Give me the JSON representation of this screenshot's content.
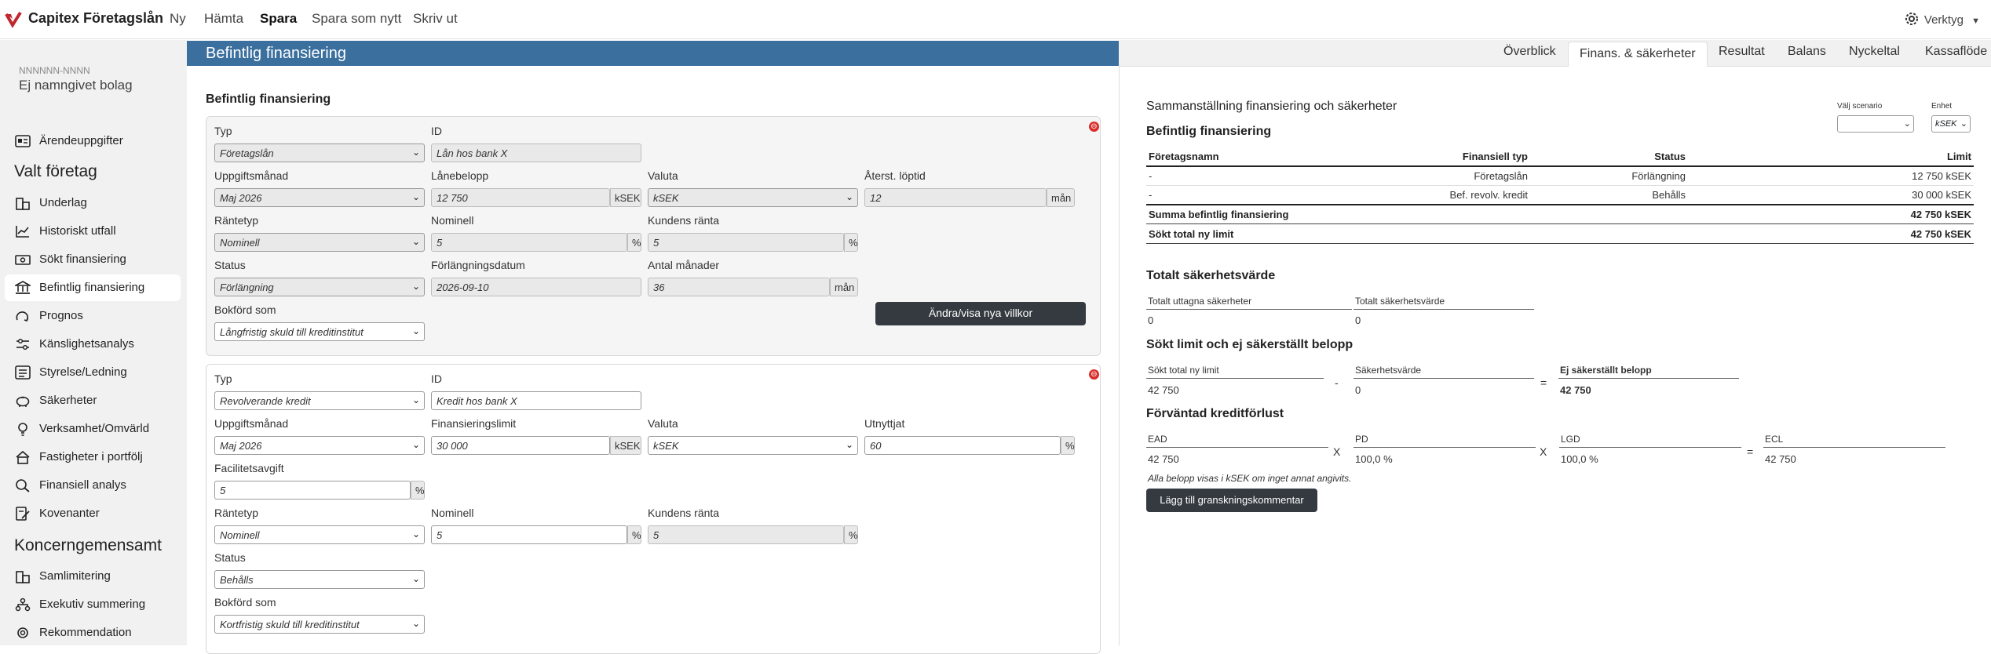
{
  "app": {
    "brand": "Capitex Företagslån"
  },
  "topnav": {
    "items": [
      "Ny",
      "Hämta",
      "Spara",
      "Spara som nytt",
      "Skriv ut"
    ],
    "tools_label": "Verktyg"
  },
  "sidebar": {
    "entity_id": "NNNNNN-NNNN",
    "entity_name": "Ej namngivet bolag",
    "top_item": "Ärendeuppgifter",
    "group1_title": "Valt företag",
    "group1_items": [
      "Underlag",
      "Historiskt utfall",
      "Sökt finansiering",
      "Befintlig finansiering",
      "Prognos",
      "Känslighetsanalys",
      "Styrelse/Ledning",
      "Säkerheter",
      "Verksamhet/Omvärld",
      "Fastigheter i portfölj",
      "Finansiell analys",
      "Kovenanter"
    ],
    "group2_title": "Koncerngemensamt",
    "group2_items": [
      "Samlimitering",
      "Exekutiv summering",
      "Rekommendation"
    ]
  },
  "mid": {
    "header": "Befintlig finansiering",
    "section_title": "Befintlig finansiering",
    "loan1": {
      "typ_label": "Typ",
      "typ": "Företagslån",
      "id_label": "ID",
      "id": "Lån hos bank X",
      "month_label": "Uppgiftsmånad",
      "month": "Maj 2026",
      "amount_label": "Lånebelopp",
      "amount": "12 750",
      "amount_unit": "kSEK",
      "currency_label": "Valuta",
      "currency": "kSEK",
      "remaining_label": "Återst. löptid",
      "remaining": "12",
      "remaining_unit": "mån",
      "rate_type_label": "Räntetyp",
      "rate_type": "Nominell",
      "nominal_label": "Nominell",
      "nominal": "5",
      "nominal_unit": "%",
      "customer_rate_label": "Kundens ränta",
      "customer_rate": "5",
      "customer_rate_unit": "%",
      "status_label": "Status",
      "status": "Förlängning",
      "ext_date_label": "Förlängningsdatum",
      "ext_date": "2026-09-10",
      "months_label": "Antal månader",
      "months": "36",
      "months_unit": "mån",
      "booked_label": "Bokförd som",
      "booked": "Långfristig skuld till kreditinstitut",
      "button": "Ändra/visa nya villkor"
    },
    "loan2": {
      "typ_label": "Typ",
      "typ": "Revolverande kredit",
      "id_label": "ID",
      "id": "Kredit hos bank X",
      "month_label": "Uppgiftsmånad",
      "month": "Maj 2026",
      "limit_label": "Finansieringslimit",
      "limit": "30 000",
      "limit_unit": "kSEK",
      "currency_label": "Valuta",
      "currency": "kSEK",
      "used_label": "Utnyttjat",
      "used": "60",
      "used_unit": "%",
      "fee_label": "Facilitetsavgift",
      "fee": "5",
      "fee_unit": "%",
      "rate_type_label": "Räntetyp",
      "rate_type": "Nominell",
      "nominal_label": "Nominell",
      "nominal": "5",
      "nominal_unit": "%",
      "customer_rate_label": "Kundens ränta",
      "customer_rate": "5",
      "customer_rate_unit": "%",
      "status_label": "Status",
      "status": "Behålls",
      "booked_label": "Bokförd som",
      "booked": "Kortfristig skuld till kreditinstitut"
    }
  },
  "tabs": [
    "Överblick",
    "Finans. & säkerheter",
    "Resultat",
    "Balans",
    "Nyckeltal",
    "Kassaflöde"
  ],
  "right": {
    "title": "Sammanställning finansiering och säkerheter",
    "scenario_label": "Välj scenario",
    "scenario_value": "",
    "unit_label": "Enhet",
    "unit_value": "kSEK",
    "sub1": "Befintlig finansiering",
    "table_headers": [
      "Företagsnamn",
      "Finansiell typ",
      "Status",
      "Limit"
    ],
    "rows": [
      [
        "-",
        "Företagslån",
        "Förlängning",
        "12 750 kSEK"
      ],
      [
        "-",
        "Bef. revolv. kredit",
        "Behålls",
        "30 000 kSEK"
      ]
    ],
    "sum_label": "Summa befintlig finansiering",
    "sum_value": "42 750 kSEK",
    "sought_label": "Sökt total ny limit",
    "sought_value": "42 750 kSEK",
    "sec2": "Totalt säkerhetsvärde",
    "sec2_l1": "Totalt uttagna säkerheter",
    "sec2_v1": "0",
    "sec2_l2": "Totalt säkerhetsvärde",
    "sec2_v2": "0",
    "sec3": "Sökt limit och ej säkerställt belopp",
    "sec3_l1": "Sökt total ny limit",
    "sec3_v1": "42 750",
    "sec3_op1": "-",
    "sec3_l2": "Säkerhetsvärde",
    "sec3_v2": "0",
    "sec3_op2": "=",
    "sec3_l3": "Ej säkerställt belopp",
    "sec3_v3": "42 750",
    "sec4": "Förväntad kreditförlust",
    "ead_label": "EAD",
    "ead": "42 750",
    "op_x1": "X",
    "pd_label": "PD",
    "pd": "100,0 %",
    "op_x2": "X",
    "lgd_label": "LGD",
    "lgd": "100,0 %",
    "op_eq": "=",
    "ecl_label": "ECL",
    "ecl": "42 750",
    "note": "Alla belopp visas i kSEK om inget annat angivits.",
    "comment_button": "Lägg till granskningskommentar"
  }
}
